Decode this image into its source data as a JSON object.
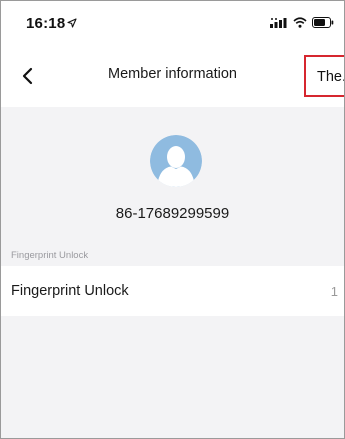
{
  "status_bar": {
    "time": "16:18",
    "icons": [
      "location-arrow-icon",
      "signal-icon",
      "wifi-icon",
      "battery-icon"
    ]
  },
  "nav": {
    "title": "Member information",
    "right_label": "The.",
    "back_icon": "chevron-left-icon"
  },
  "profile": {
    "avatar_icon": "user-avatar-icon",
    "phone": "86-17689299599",
    "avatar_color": "#8fbbe0"
  },
  "section": {
    "label": "Fingerprint Unlock"
  },
  "list": {
    "items": [
      {
        "label": "Fingerprint Unlock",
        "value": "1"
      }
    ]
  },
  "colors": {
    "highlight_border": "#d6262f",
    "background": "#f3f3f5"
  }
}
